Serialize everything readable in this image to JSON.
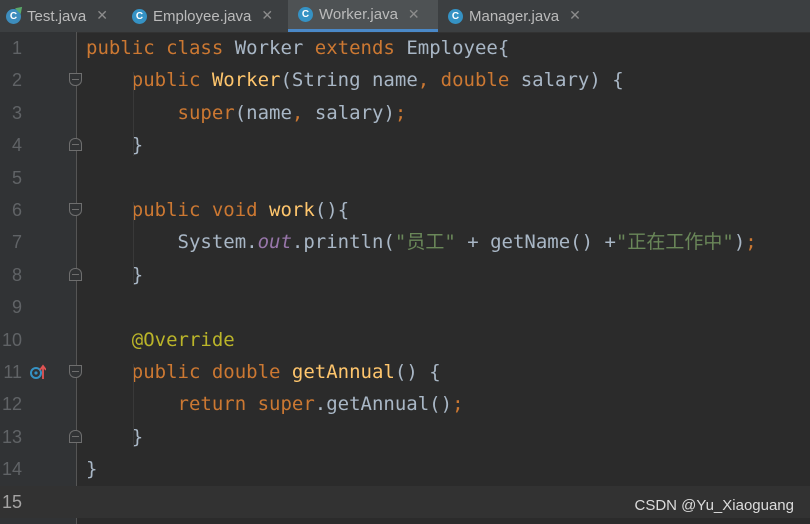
{
  "tabs": [
    {
      "label": "Test.java",
      "icon": "test-class-icon",
      "active": false
    },
    {
      "label": "Employee.java",
      "icon": "class-icon",
      "active": false
    },
    {
      "label": "Worker.java",
      "icon": "class-icon",
      "active": true
    },
    {
      "label": "Manager.java",
      "icon": "class-icon",
      "active": false
    }
  ],
  "close_glyph": "✕",
  "class_glyph": "C",
  "current_line": 15,
  "lines": [
    {
      "num": "1",
      "tokens": [
        [
          "kw",
          "public class "
        ],
        [
          "",
          "Worker "
        ],
        [
          "kw",
          "extends "
        ],
        [
          "",
          "Employee{"
        ]
      ]
    },
    {
      "num": "2",
      "tokens": [
        [
          "",
          "    "
        ],
        [
          "kw",
          "public "
        ],
        [
          "fn",
          "Worker"
        ],
        [
          "",
          "(String name"
        ],
        [
          "kw",
          ", double "
        ],
        [
          "",
          "salary) {"
        ]
      ]
    },
    {
      "num": "3",
      "tokens": [
        [
          "",
          "        "
        ],
        [
          "kw",
          "super"
        ],
        [
          "",
          "(name"
        ],
        [
          "kw",
          ", "
        ],
        [
          "",
          "salary)"
        ],
        [
          "kw",
          ";"
        ]
      ]
    },
    {
      "num": "4",
      "tokens": [
        [
          "",
          "    }"
        ]
      ]
    },
    {
      "num": "5",
      "tokens": []
    },
    {
      "num": "6",
      "tokens": [
        [
          "",
          "    "
        ],
        [
          "kw",
          "public void "
        ],
        [
          "fn",
          "work"
        ],
        [
          "",
          "(){"
        ]
      ]
    },
    {
      "num": "7",
      "tokens": [
        [
          "",
          "        System."
        ],
        [
          "sf",
          "out"
        ],
        [
          "",
          ".println("
        ],
        [
          "st",
          "\"员工\""
        ],
        [
          "",
          " + getName() +"
        ],
        [
          "st",
          "\"正在工作中\""
        ],
        [
          "",
          ")"
        ],
        [
          "kw",
          ";"
        ]
      ]
    },
    {
      "num": "8",
      "tokens": [
        [
          "",
          "    }"
        ]
      ]
    },
    {
      "num": "9",
      "tokens": []
    },
    {
      "num": "10",
      "tokens": [
        [
          "",
          "    "
        ],
        [
          "an",
          "@Override"
        ]
      ]
    },
    {
      "num": "11",
      "tokens": [
        [
          "",
          "    "
        ],
        [
          "kw",
          "public double "
        ],
        [
          "fn",
          "getAnnual"
        ],
        [
          "",
          "() {"
        ]
      ]
    },
    {
      "num": "12",
      "tokens": [
        [
          "",
          "        "
        ],
        [
          "kw",
          "return super"
        ],
        [
          "",
          ".getAnnual()"
        ],
        [
          "kw",
          ";"
        ]
      ]
    },
    {
      "num": "13",
      "tokens": [
        [
          "",
          "    }"
        ]
      ]
    },
    {
      "num": "14",
      "tokens": [
        [
          "",
          "}"
        ]
      ]
    },
    {
      "num": "15",
      "tokens": []
    }
  ],
  "watermark": "CSDN @Yu_Xiaoguang",
  "colors": {
    "keyword": "#cc7832",
    "method": "#ffc66d",
    "string": "#6a8759",
    "static_field": "#9876aa",
    "annotation": "#bbb529",
    "text": "#a9b7c6",
    "background": "#2b2b2b",
    "accent": "#4a88c7"
  }
}
